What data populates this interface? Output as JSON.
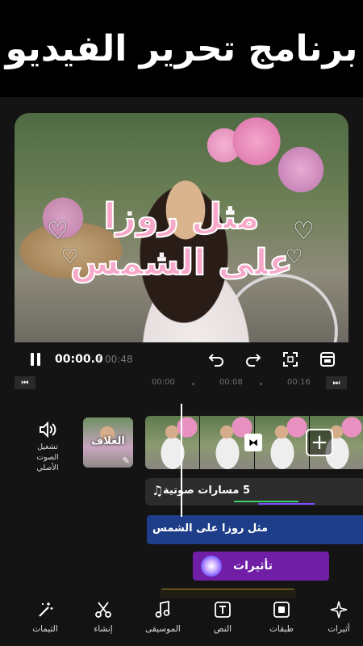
{
  "banner": {
    "title": "برنامج تحرير الفيديو"
  },
  "preview": {
    "overlay_line1": "مثل روزا",
    "overlay_line2": "على الشمس"
  },
  "playback": {
    "current_time": "00:00.0",
    "separator": "/",
    "total_time": "00:48"
  },
  "ruler": {
    "marks": [
      "00:00",
      "00:08",
      "00:16"
    ]
  },
  "timeline": {
    "original_audio_label_line1": "تشغيل الصوت",
    "original_audio_label_line2": "الأصلي",
    "cover_label": "الغلاف",
    "audio_track_label": "5 مسارات صوتية",
    "text_track_label": "مثل روزا على الشمس",
    "effects_track_label": "تأثيرات"
  },
  "toolbar": {
    "items": [
      {
        "label": "أثيرات",
        "icon": "sparkle-icon"
      },
      {
        "label": "طبقات",
        "icon": "layers-icon"
      },
      {
        "label": "النص",
        "icon": "text-icon"
      },
      {
        "label": "الموسيقى",
        "icon": "music-icon"
      },
      {
        "label": "إنشاء",
        "icon": "scissors-icon"
      },
      {
        "label": "الثيمات",
        "icon": "magic-wand-icon"
      }
    ]
  }
}
